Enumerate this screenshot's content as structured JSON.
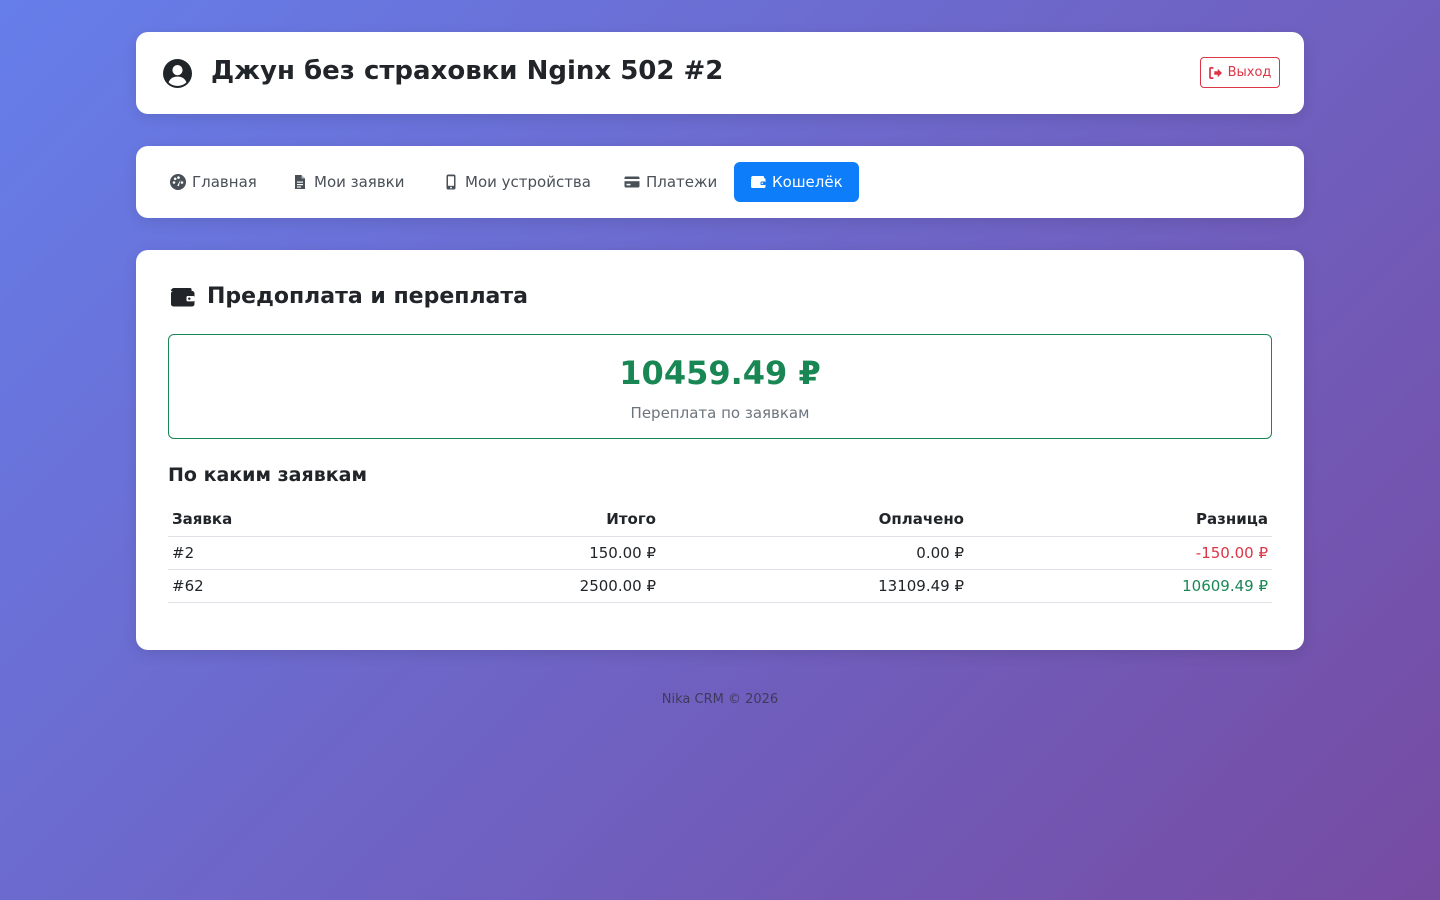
{
  "header": {
    "title": "Джун без страховки Nginx 502 #2",
    "logout_label": "Выход",
    "user_icon": "user-circle-icon"
  },
  "nav": {
    "items": [
      {
        "label": "Главная",
        "icon": "dashboard-icon",
        "active": false
      },
      {
        "label": "Мои заявки",
        "icon": "document-icon",
        "active": false
      },
      {
        "label": "Мои устройства",
        "icon": "mobile-icon",
        "active": false
      },
      {
        "label": "Платежи",
        "icon": "credit-card-icon",
        "active": false
      },
      {
        "label": "Кошелёк",
        "icon": "wallet-icon",
        "active": true
      }
    ]
  },
  "wallet": {
    "title": "Предоплата и переплата",
    "balance": "10459.49 ₽",
    "balance_label": "Переплата по заявкам",
    "orders_title": "По каким заявкам",
    "columns": [
      "Заявка",
      "Итого",
      "Оплачено",
      "Разница"
    ],
    "rows": [
      {
        "order": "#2",
        "total": "150.00 ₽",
        "paid": "0.00 ₽",
        "diff": "-150.00 ₽",
        "status": "negative"
      },
      {
        "order": "#62",
        "total": "2500.00 ₽",
        "paid": "13109.49 ₽",
        "diff": "10609.49 ₽",
        "status": "positive"
      }
    ]
  },
  "footer": {
    "text": "Nika CRM © 2026"
  },
  "colors": {
    "accent": "#0d7df9",
    "success": "#198754",
    "danger": "#dc3545",
    "bg_start": "#667eea",
    "bg_end": "#764ba2"
  }
}
